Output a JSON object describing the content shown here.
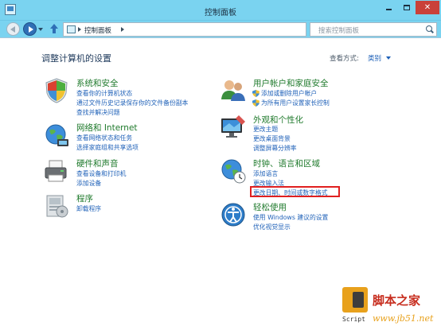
{
  "window": {
    "title": "控制面板",
    "minimize_label": "",
    "maximize_label": "",
    "close_label": "✕"
  },
  "address_bar": {
    "path": "控制面板",
    "search_placeholder": "搜索控制面板"
  },
  "header": {
    "title": "调整计算机的设置",
    "view_by_label": "查看方式:",
    "view_by_value": "类别"
  },
  "categories": {
    "system_security": {
      "title": "系统和安全",
      "links": [
        "查看你的计算机状态",
        "通过文件历史记录保存你的文件备份副本",
        "查找并解决问题"
      ]
    },
    "network_internet": {
      "title": "网络和 Internet",
      "links": [
        "查看网络状态和任务",
        "选择家庭组和共享选项"
      ]
    },
    "hardware_sound": {
      "title": "硬件和声音",
      "links": [
        "查看设备和打印机",
        "添加设备"
      ]
    },
    "programs": {
      "title": "程序",
      "links": [
        "卸载程序"
      ]
    },
    "user_accounts": {
      "title": "用户帐户和家庭安全",
      "links": [
        "添加或删除用户帐户",
        "为所有用户设置家长控制"
      ]
    },
    "appearance": {
      "title": "外观和个性化",
      "links": [
        "更改主题",
        "更改桌面背景",
        "调整屏幕分辨率"
      ]
    },
    "clock_region": {
      "title": "时钟、语言和区域",
      "links": [
        "添加语言",
        "更改输入法",
        "更改日期、时间或数字格式"
      ]
    },
    "ease_of_access": {
      "title": "轻松使用",
      "links": [
        "使用 Windows 建议的设置",
        "优化视觉显示"
      ]
    }
  },
  "watermark": {
    "logo_letter": "J",
    "script_text": "Script",
    "site_name": "脚本之家",
    "site_url": "www.jb51.net"
  },
  "colors": {
    "titlebar": "#7ad3f0",
    "category_title": "#1f7a2c",
    "link": "#1f61b8",
    "highlight": "#e02020"
  }
}
